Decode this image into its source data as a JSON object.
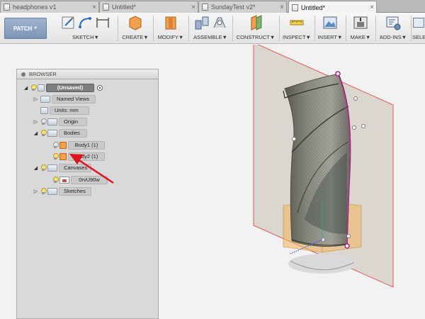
{
  "tabs": [
    {
      "label": "headphones v1",
      "active": false
    },
    {
      "label": "Untitled*",
      "active": false
    },
    {
      "label": "SundayTest v2*",
      "active": false
    },
    {
      "label": "Untitled*",
      "active": true
    }
  ],
  "toolbar": {
    "workspace": "PATCH",
    "groups": [
      {
        "id": "sketch",
        "label": "SKETCH"
      },
      {
        "id": "create",
        "label": "CREATE"
      },
      {
        "id": "modify",
        "label": "MODIFY"
      },
      {
        "id": "assemble",
        "label": "ASSEMBLE"
      },
      {
        "id": "construct",
        "label": "CONSTRUCT"
      },
      {
        "id": "inspect",
        "label": "INSPECT"
      },
      {
        "id": "insert",
        "label": "INSERT"
      },
      {
        "id": "make",
        "label": "MAKE"
      },
      {
        "id": "addins",
        "label": "ADD-INS"
      },
      {
        "id": "select",
        "label": "SELE"
      }
    ],
    "dropdown_glyph": "▼"
  },
  "browser": {
    "title": "BROWSER",
    "root": "(Unsaved)",
    "named_views": "Named Views",
    "units": "Units: mm",
    "origin": "Origin",
    "bodies": "Bodies",
    "body1": "Body1 (1)",
    "body2": "Body2 (1)",
    "canvases": "Canvases",
    "canvas_item": "0rvU90w",
    "sketches": "Sketches"
  },
  "colors": {
    "accent_arrow": "#e0141b",
    "body_orange": "#f5a04e",
    "plane_red": "#e35a5a",
    "sketch_point": "#b0208a"
  }
}
